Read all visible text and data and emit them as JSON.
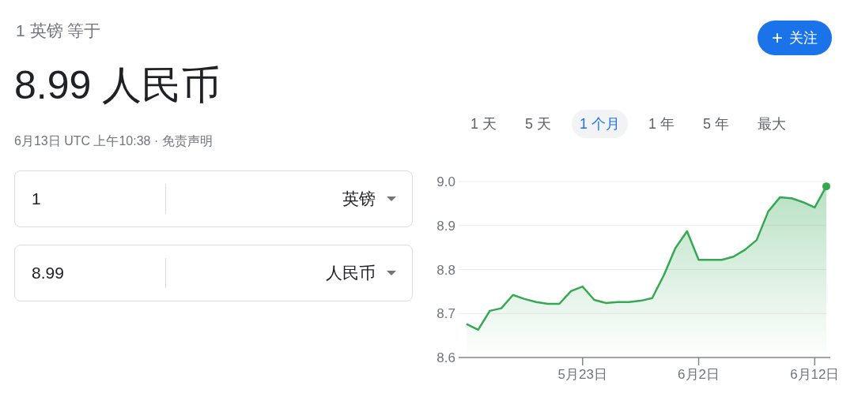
{
  "header": {
    "subtitle": "1 英镑 等于",
    "result": "8.99 人民币",
    "timestamp": "6月13日 UTC 上午10:38 · ",
    "disclaimer_link": "免责声明"
  },
  "follow_button": {
    "icon": "+",
    "label": "关注"
  },
  "converter": [
    {
      "value": "1",
      "currency": "英镑"
    },
    {
      "value": "8.99",
      "currency": "人民币"
    }
  ],
  "range_tabs": [
    {
      "label": "1 天",
      "selected": false
    },
    {
      "label": "5 天",
      "selected": false
    },
    {
      "label": "1 个月",
      "selected": true
    },
    {
      "label": "1 年",
      "selected": false
    },
    {
      "label": "5 年",
      "selected": false
    },
    {
      "label": "最大",
      "selected": false
    }
  ],
  "chart": {
    "chart_data": {
      "type": "area",
      "categories": [
        null,
        null,
        null,
        null,
        null,
        null,
        null,
        null,
        null,
        null,
        "5月23日",
        null,
        null,
        null,
        null,
        null,
        null,
        null,
        null,
        null,
        "6月2日",
        null,
        null,
        null,
        null,
        null,
        null,
        null,
        null,
        null,
        "6月12日",
        null
      ],
      "series": [
        {
          "color": "#34a853",
          "values": [
            8.676,
            8.663,
            8.706,
            8.712,
            8.742,
            8.733,
            8.726,
            8.722,
            8.722,
            8.751,
            8.761,
            8.731,
            8.724,
            8.726,
            8.726,
            8.729,
            8.735,
            8.787,
            8.849,
            8.887,
            8.822,
            8.822,
            8.822,
            8.829,
            8.845,
            8.867,
            8.932,
            8.964,
            8.962,
            8.953,
            8.941,
            8.989
          ]
        }
      ],
      "ylim": [
        8.6,
        9.0
      ],
      "grid": true,
      "yticks": [
        {
          "value": 8.6,
          "label": "8.6"
        },
        {
          "value": 8.7,
          "label": "8.7"
        },
        {
          "value": 8.8,
          "label": "8.8"
        },
        {
          "value": 8.9,
          "label": "8.9"
        },
        {
          "value": 9.0,
          "label": "9.0"
        }
      ]
    }
  }
}
